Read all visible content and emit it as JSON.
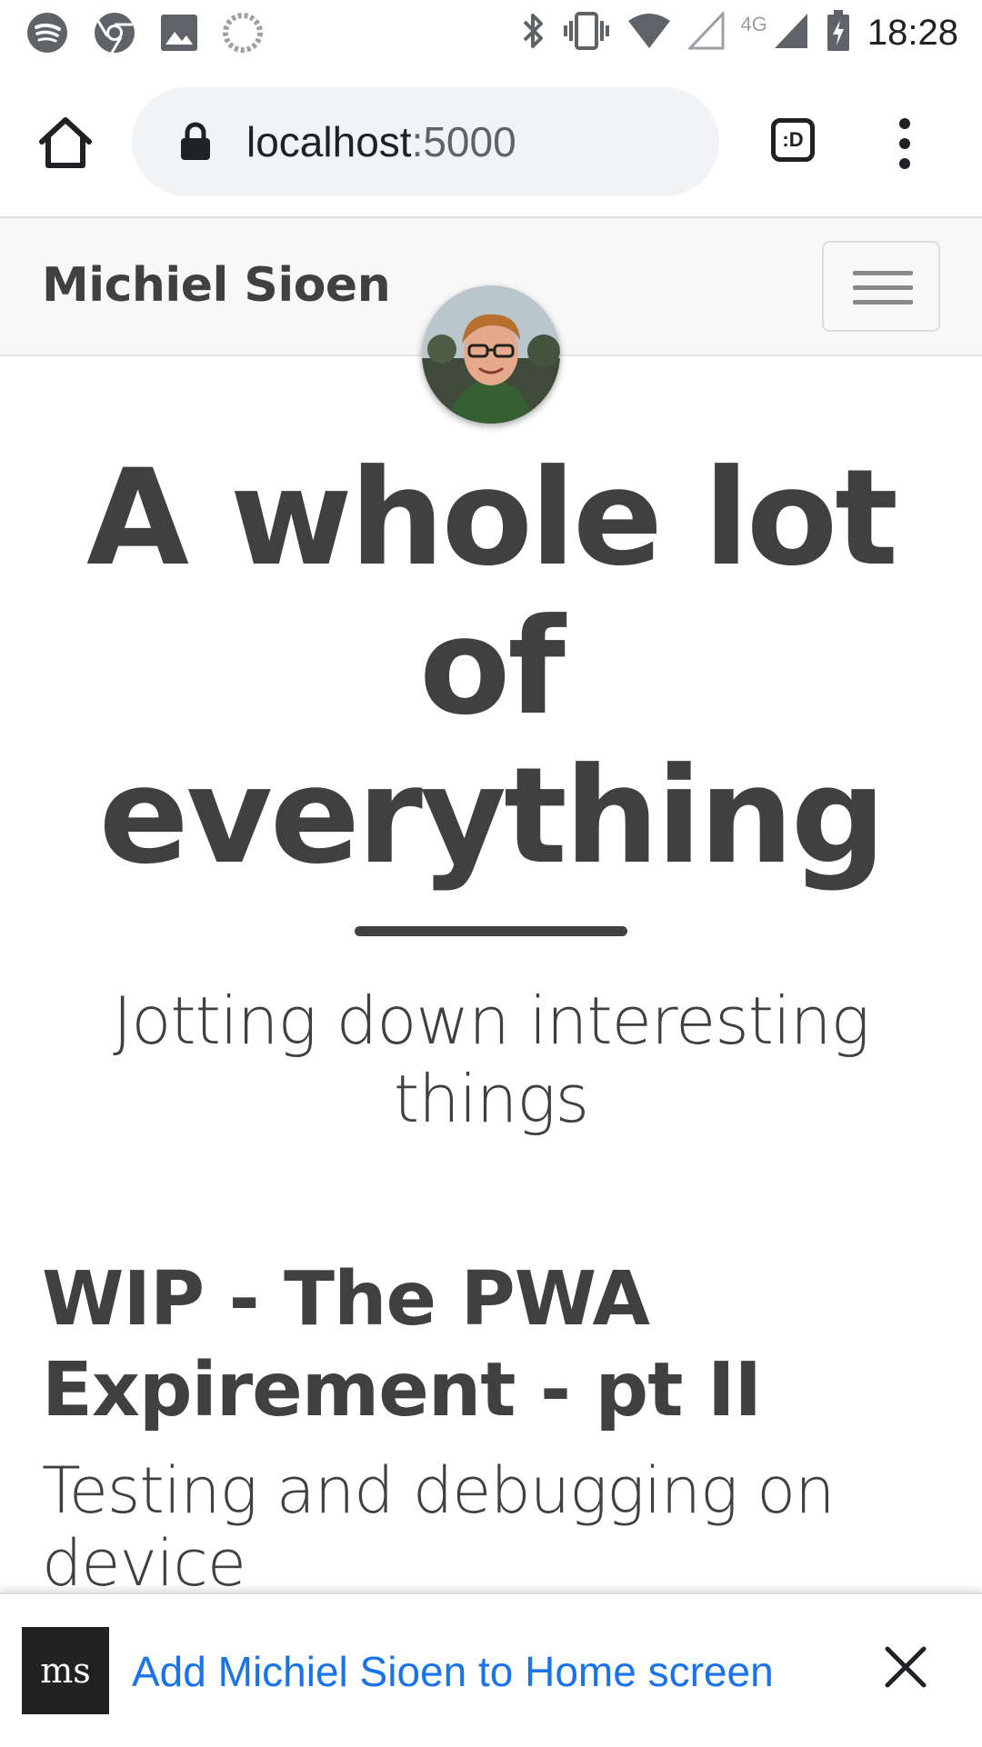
{
  "status_bar": {
    "time": "18:28",
    "network_label": "4G",
    "left_icons": [
      "spotify-icon",
      "chrome-icon",
      "gallery-icon",
      "loading-icon"
    ],
    "right_icons": [
      "bluetooth-icon",
      "vibrate-icon",
      "wifi-icon",
      "signal-empty-icon",
      "signal-icon",
      "battery-charging-icon"
    ]
  },
  "browser": {
    "url_host": "localhost",
    "url_port": ":5000",
    "tab_switcher_label": ":D"
  },
  "navbar": {
    "brand": "Michiel Sioen"
  },
  "hero": {
    "title": "A whole lot of everything",
    "subtitle": "Jotting down interesting things"
  },
  "post": {
    "title": "WIP - The PWA Expirement - pt II",
    "subtitle": "Testing and debugging on device"
  },
  "add_to_home": {
    "icon_text": "ms",
    "label": "Add Michiel Sioen to Home screen"
  },
  "colors": {
    "text": "#404040",
    "link_blue": "#1a73e8",
    "navbar_bg": "#f8f8f8",
    "omnibox_bg": "#f1f3f4"
  }
}
